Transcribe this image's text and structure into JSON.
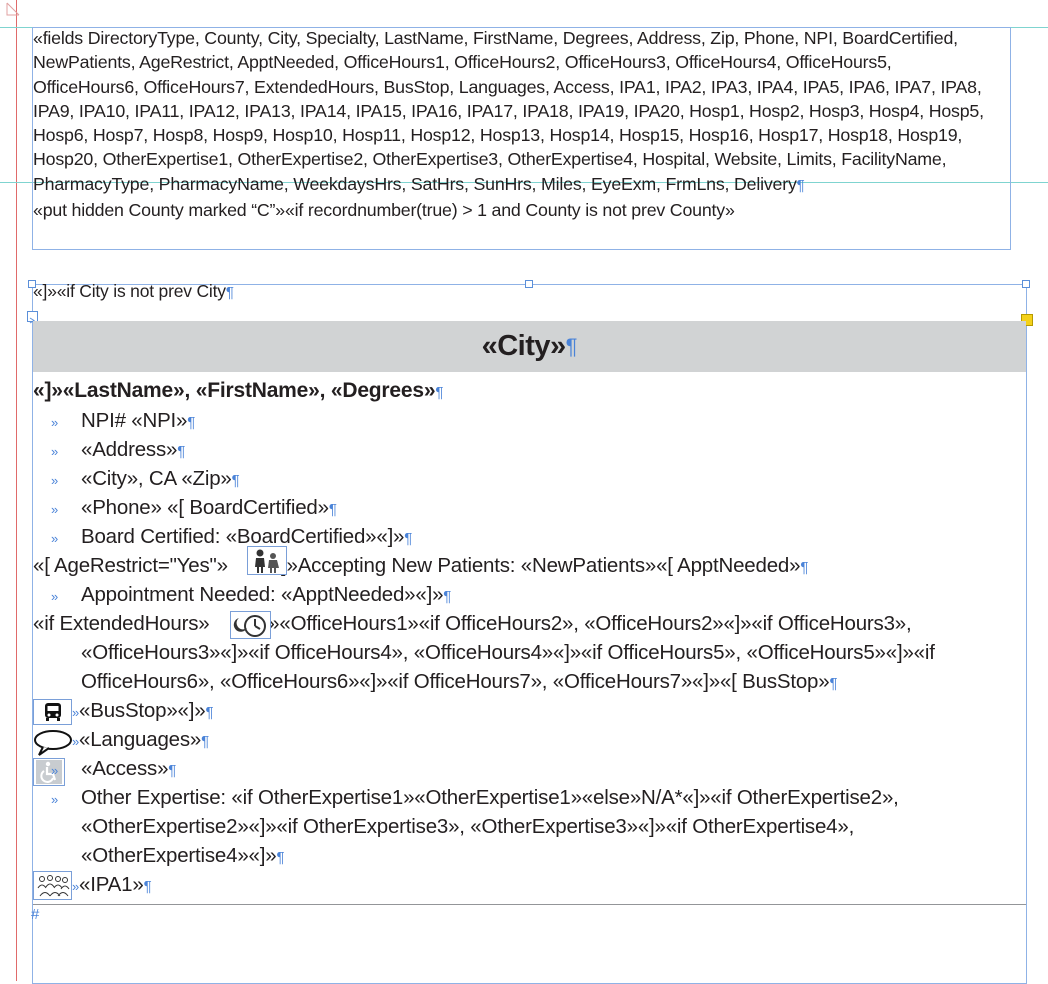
{
  "colors": {
    "frame_border": "#8fb2e6",
    "guide_cyan": "#7fd4d0",
    "margin_red": "#e06a6a",
    "hidden_char_blue": "#4a83d8",
    "city_header_bg": "#d1d3d4",
    "selection_yellow": "#f4d11a"
  },
  "glyphs": {
    "pilcrow": "¶",
    "tab": "»",
    "end_of_story": "#"
  },
  "top_frame": {
    "lines": [
      "«fields DirectoryType, County, City, Specialty, LastName, FirstName, Degrees, Address, Zip, Phone, NPI, BoardCertified,",
      "NewPatients, AgeRestrict, ApptNeeded, OfficeHours1, OfficeHours2, OfficeHours3, OfficeHours4, OfficeHours5,",
      "OfficeHours6, OfficeHours7, ExtendedHours, BusStop, Languages, Access, IPA1, IPA2, IPA3, IPA4, IPA5, IPA6, IPA7, IPA8,",
      "IPA9, IPA10, IPA11, IPA12, IPA13, IPA14, IPA15, IPA16, IPA17, IPA18, IPA19, IPA20, Hosp1, Hosp2, Hosp3, Hosp4, Hosp5,",
      "Hosp6, Hosp7, Hosp8, Hosp9, Hosp10, Hosp11, Hosp12, Hosp13, Hosp14, Hosp15, Hosp16, Hosp17, Hosp18, Hosp19,",
      "Hosp20, OtherExpertise1, OtherExpertise2, OtherExpertise3, OtherExpertise4, Hospital, Website, Limits, FacilityName,",
      "PharmacyType, PharmacyName, WeekdaysHrs, SatHrs, SunHrs, Miles, EyeExm, FrmLns, Delivery",
      "«put hidden County marked “C”»«if recordnumber(true) > 1 and County is not prev County»"
    ]
  },
  "main_frame": {
    "if_city_line": "«]»«if City is not prev City",
    "city_header": "«City»",
    "name_line": "«]»«LastName», «FirstName», «Degrees»",
    "npi_line": "NPI# «NPI»",
    "address_line": "«Address»",
    "city_zip_line": "«City», CA «Zip»",
    "phone_line": "«Phone» «[ BoardCertified»",
    "board_line": "Board Certified: «BoardCertified»«]»",
    "age_line_a": "«[ AgeRestrict=\"Yes\"»",
    "age_line_b": "«]»Accepting New Patients: «NewPatients»«[ ApptNeeded»",
    "appt_line": "Appointment Needed: «ApptNeeded»«]»",
    "ext_line_a": "«if ExtendedHours»",
    "ext_line_b": "«]»«OfficeHours1»«if OfficeHours2», «OfficeHours2»«]»«if OfficeHours3»,",
    "ext_line_c": "«OfficeHours3»«]»«if OfficeHours4», «OfficeHours4»«]»«if OfficeHours5», «OfficeHours5»«]»«if",
    "ext_line_d": "OfficeHours6», «OfficeHours6»«]»«if OfficeHours7», «OfficeHours7»«]»«[ BusStop»",
    "bus_line": "«BusStop»«]»",
    "lang_line": "«Languages»",
    "access_line": "«Access»",
    "other_line_a": "Other Expertise: «if OtherExpertise1»«OtherExpertise1»«else»N/A*«]»«if OtherExpertise2»,",
    "other_line_b": "«OtherExpertise2»«]»«if OtherExpertise3», «OtherExpertise3»«]»«if OtherExpertise4»,",
    "other_line_c": "«OtherExpertise4»«]»",
    "ipa_line": "«IPA1»"
  },
  "icons": {
    "family": "family-icon",
    "clock": "clock-moon-icon",
    "bus": "bus-icon",
    "speech": "speech-bubble-icon",
    "wheelchair": "wheelchair-icon",
    "group": "group-people-icon"
  }
}
